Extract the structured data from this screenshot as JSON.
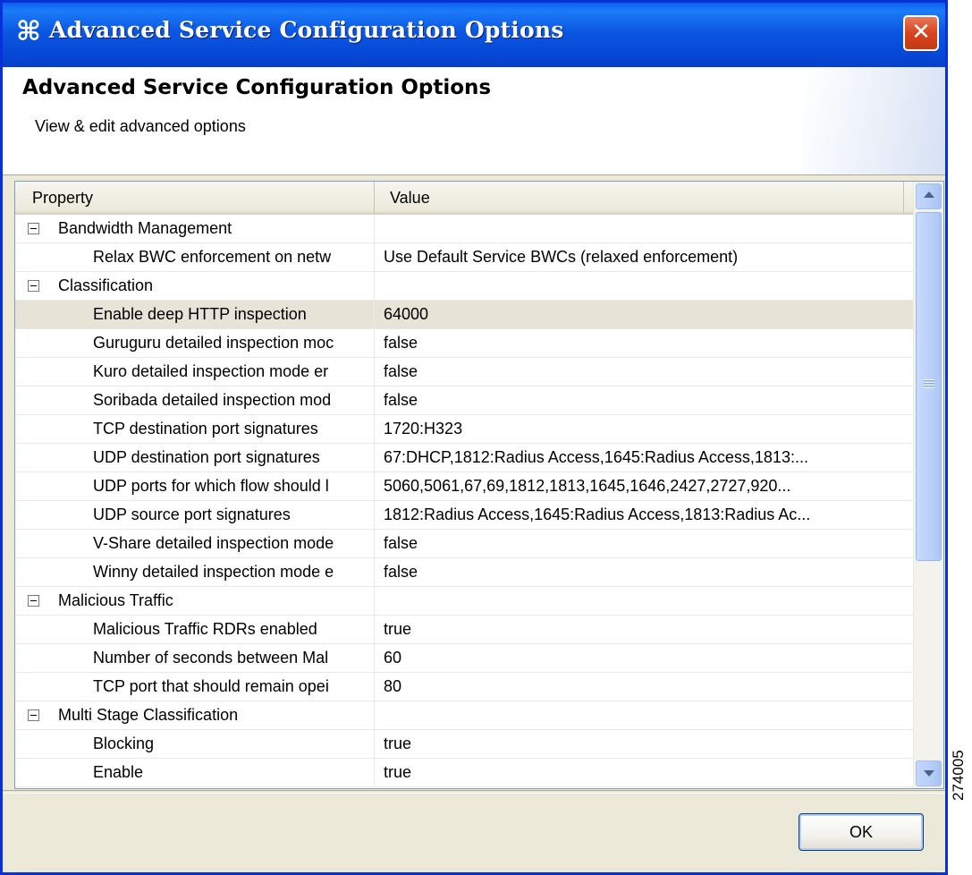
{
  "window": {
    "title": "Advanced Service Configuration Options",
    "close_glyph": "✕",
    "app_icon_glyph": "⌘"
  },
  "banner": {
    "title": "Advanced Service Configuration Options",
    "subtitle": "View & edit advanced options"
  },
  "table": {
    "columns": {
      "property": "Property",
      "value": "Value"
    },
    "rows": [
      {
        "type": "category",
        "label": "Bandwidth Management"
      },
      {
        "type": "item",
        "label": "Relax BWC enforcement on netw",
        "value": "Use Default Service BWCs (relaxed enforcement)"
      },
      {
        "type": "category",
        "label": "Classification"
      },
      {
        "type": "item",
        "label": "Enable deep HTTP inspection",
        "value": "64000",
        "selected": true
      },
      {
        "type": "item",
        "label": "Guruguru detailed inspection moc",
        "value": "false"
      },
      {
        "type": "item",
        "label": "Kuro detailed inspection mode er",
        "value": "false"
      },
      {
        "type": "item",
        "label": "Soribada detailed inspection mod",
        "value": "false"
      },
      {
        "type": "item",
        "label": "TCP destination port signatures",
        "value": "1720:H323"
      },
      {
        "type": "item",
        "label": "UDP destination port signatures",
        "value": "67:DHCP,1812:Radius Access,1645:Radius Access,1813:..."
      },
      {
        "type": "item",
        "label": "UDP ports for which flow should l",
        "value": "5060,5061,67,69,1812,1813,1645,1646,2427,2727,920..."
      },
      {
        "type": "item",
        "label": "UDP source port signatures",
        "value": "1812:Radius Access,1645:Radius Access,1813:Radius Ac..."
      },
      {
        "type": "item",
        "label": "V-Share detailed inspection mode",
        "value": "false"
      },
      {
        "type": "item",
        "label": "Winny detailed inspection mode e",
        "value": "false"
      },
      {
        "type": "category",
        "label": "Malicious Traffic"
      },
      {
        "type": "item",
        "label": "Malicious Traffic RDRs enabled",
        "value": "true"
      },
      {
        "type": "item",
        "label": "Number of seconds between Mal",
        "value": "60"
      },
      {
        "type": "item",
        "label": "TCP port that should remain opei",
        "value": "80"
      },
      {
        "type": "category",
        "label": "Multi Stage Classification"
      },
      {
        "type": "item",
        "label": "Blocking",
        "value": "true"
      },
      {
        "type": "item",
        "label": "Enable",
        "value": "true"
      }
    ]
  },
  "footer": {
    "ok_label": "OK"
  },
  "figure_id": "274005",
  "colors": {
    "titlebar": "#0648d6",
    "client_bg": "#ece9d8",
    "selected_row": "#e7e3d7",
    "close_button": "#d9431e"
  }
}
